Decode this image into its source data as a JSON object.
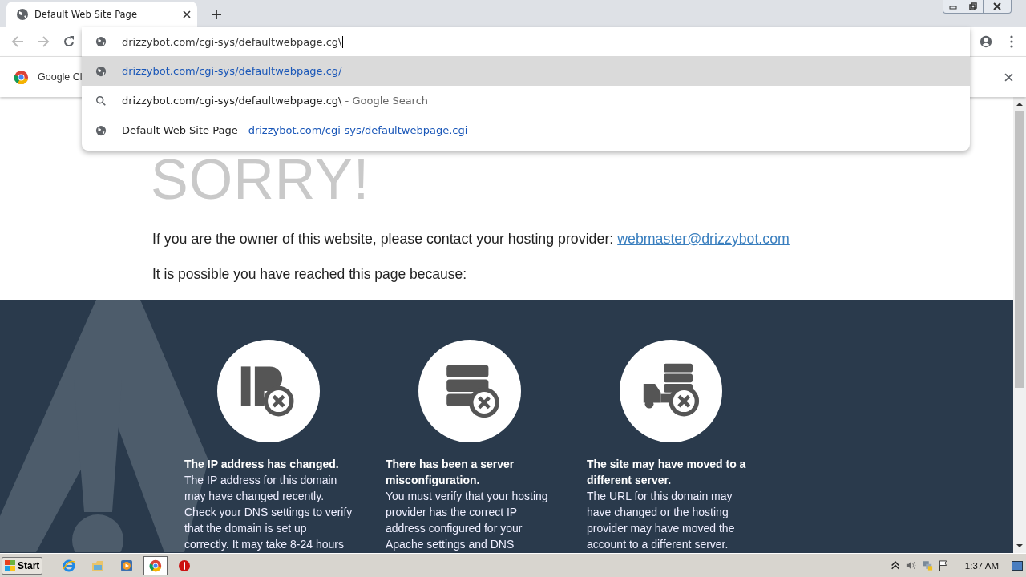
{
  "tabs": [
    {
      "title": "Default Web Site Page",
      "selected": true
    }
  ],
  "address_bar": {
    "value": "drizzybot.com/cgi-sys/defaultwebpage.cg\\"
  },
  "suggestions": [
    {
      "kind": "url",
      "selected": true,
      "text": "drizzybot.com/cgi-sys/defaultwebpage.cg/"
    },
    {
      "kind": "search",
      "selected": false,
      "text": "drizzybot.com/cgi-sys/defaultwebpage.cg\\",
      "detail": " - Google Search"
    },
    {
      "kind": "history",
      "selected": false,
      "text": "Default Web Site Page - ",
      "detail": "drizzybot.com/cgi-sys/defaultwebpage.cgi"
    }
  ],
  "info_bar": {
    "text": "Google Cl"
  },
  "page": {
    "heading": "SORRY!",
    "contact": {
      "text": "If you are the owner of this website, please contact your hosting provider: ",
      "link": "webmaster@drizzybot.com"
    },
    "intro": "It is possible you have reached this page because:",
    "reasons": [
      {
        "kind": "ip",
        "title": "The IP address has changed.",
        "body": "The IP address for this domain may have changed recently. Check your DNS settings to verify that the domain is set up correctly. It may take 8-24 hours"
      },
      {
        "kind": "server",
        "title": "There has been a server misconfiguration.",
        "body": "You must verify that your hosting provider has the correct IP address configured for your Apache settings and DNS"
      },
      {
        "kind": "truck",
        "title": "The site may have moved to a different server.",
        "body": "The URL for this domain may have changed or the hosting provider may have moved the account to a different server."
      }
    ]
  },
  "taskbar": {
    "start": "Start",
    "apps": [
      {
        "kind": "ie",
        "active": false
      },
      {
        "kind": "folder",
        "active": false
      },
      {
        "kind": "media",
        "active": false
      },
      {
        "kind": "chrome",
        "active": true
      },
      {
        "kind": "stop",
        "active": false
      }
    ],
    "clock": "1:37 AM"
  }
}
